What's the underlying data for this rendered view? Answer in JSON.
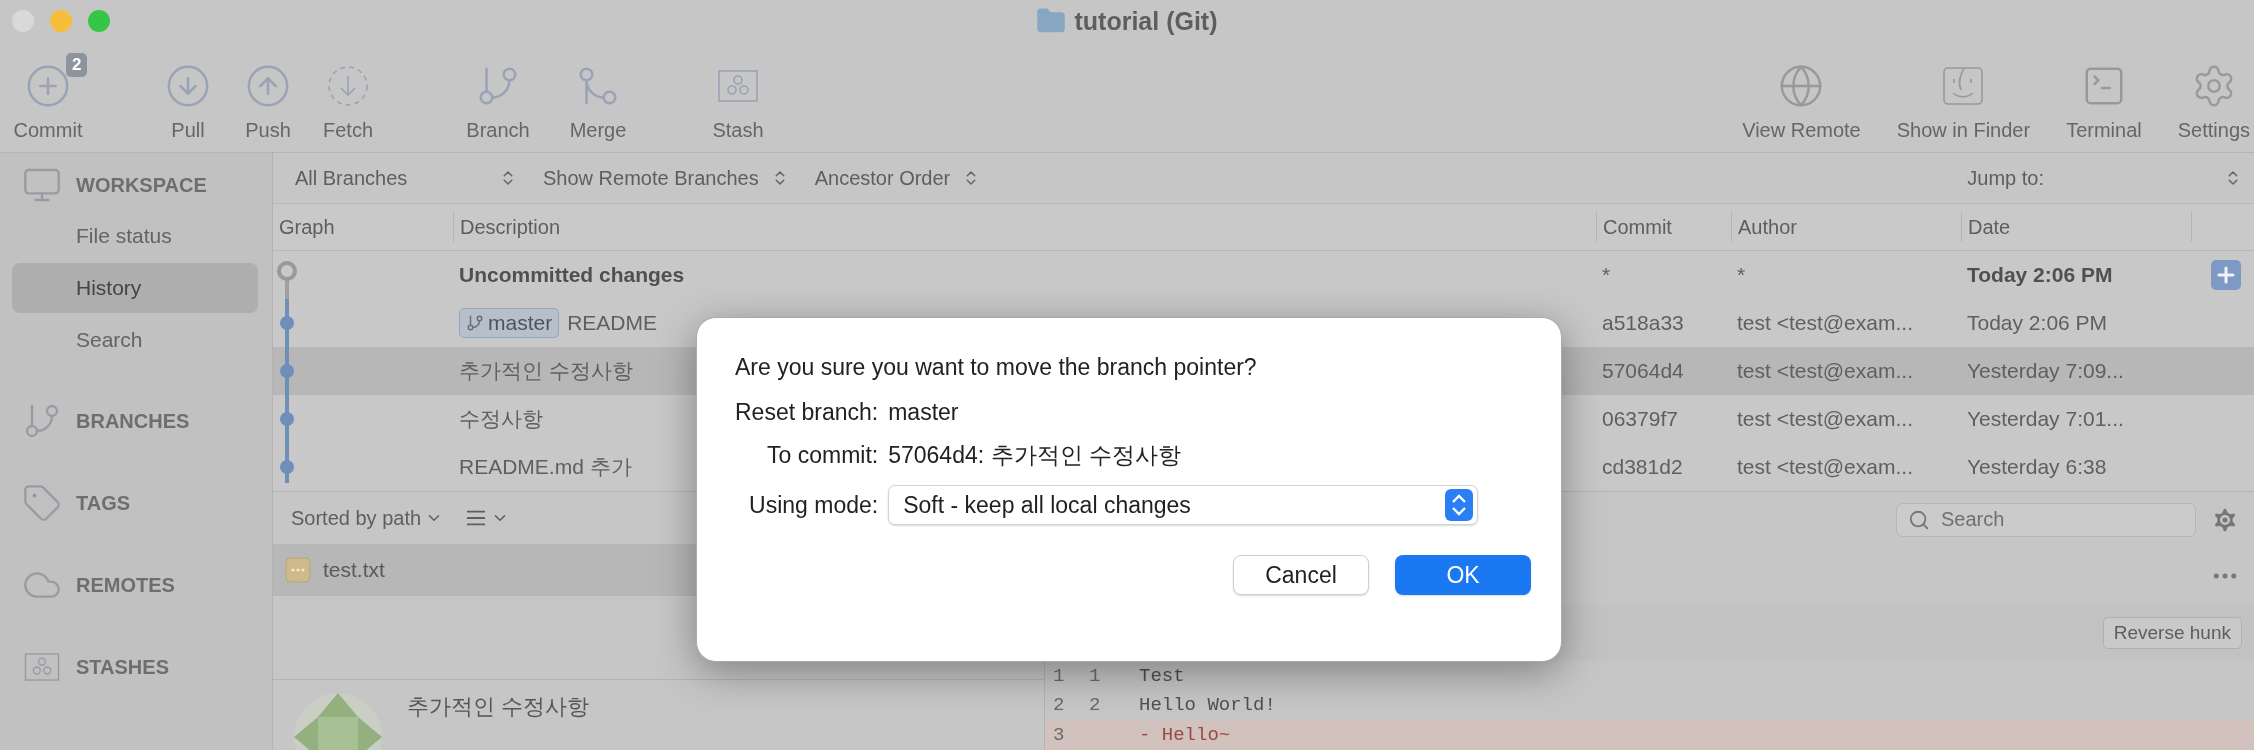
{
  "window": {
    "title": "tutorial (Git)"
  },
  "toolbar": {
    "left": [
      [
        {
          "kind": "commit",
          "label": "Commit",
          "badge": "2"
        }
      ],
      [
        {
          "kind": "pull",
          "label": "Pull"
        },
        {
          "kind": "push",
          "label": "Push"
        },
        {
          "kind": "fetch",
          "label": "Fetch"
        }
      ],
      [
        {
          "kind": "branch",
          "label": "Branch"
        },
        {
          "kind": "merge",
          "label": "Merge"
        }
      ],
      [
        {
          "kind": "stash",
          "label": "Stash"
        }
      ]
    ],
    "right": [
      {
        "kind": "remote",
        "label": "View Remote"
      },
      {
        "kind": "finder",
        "label": "Show in Finder"
      },
      {
        "kind": "terminal",
        "label": "Terminal"
      },
      {
        "kind": "settings",
        "label": "Settings"
      }
    ]
  },
  "sidebar": [
    {
      "kind": "workspace",
      "title": "WORKSPACE",
      "items": [
        {
          "label": "File status",
          "selected": false
        },
        {
          "label": "History",
          "selected": true
        },
        {
          "label": "Search",
          "selected": false
        }
      ]
    },
    {
      "kind": "branches",
      "title": "BRANCHES"
    },
    {
      "kind": "tags",
      "title": "TAGS"
    },
    {
      "kind": "remotes",
      "title": "REMOTES"
    },
    {
      "kind": "stashes",
      "title": "STASHES"
    }
  ],
  "filters": [
    "All Branches",
    "Show Remote Branches",
    "Ancestor Order"
  ],
  "jump_to": {
    "label": "Jump to:"
  },
  "table": {
    "columns": [
      "Graph",
      "Description",
      "Commit",
      "Author",
      "Date"
    ],
    "rows": [
      {
        "kind": "uncommitted",
        "description": "Uncommitted changes",
        "commit": "*",
        "author": "*",
        "date": "Today 2:06 PM",
        "selected": false
      },
      {
        "kind": "commit",
        "branch": "master",
        "description": "README",
        "commit": "a518a33",
        "author": "test <test@exam...",
        "date": "Today 2:06 PM",
        "selected": false
      },
      {
        "kind": "commit",
        "description": "추가적인 수정사항",
        "commit": "57064d4",
        "author": "test <test@exam...",
        "date": "Yesterday 7:09...",
        "selected": true
      },
      {
        "kind": "commit",
        "description": "수정사항",
        "commit": "06379f7",
        "author": "test <test@exam...",
        "date": "Yesterday 7:01...",
        "selected": false
      },
      {
        "kind": "commit",
        "description": "README.md 추가",
        "commit": "cd381d2",
        "author": "test <test@exam...",
        "date": "Yesterday 6:38",
        "selected": false
      }
    ]
  },
  "files": {
    "sort": "Sorted by path",
    "items": [
      {
        "name": "test.txt",
        "selected": true
      }
    ]
  },
  "commit_detail": {
    "title": "추가적인 수정사항"
  },
  "diff": {
    "search": {
      "placeholder": "Search"
    },
    "reverse_hunk": "Reverse hunk",
    "lines": [
      {
        "kind": "context",
        "old": "1",
        "new": "1",
        "text": "Test"
      },
      {
        "kind": "context",
        "old": "2",
        "new": "2",
        "text": "Hello World!"
      },
      {
        "kind": "removed",
        "old": "3",
        "marker": "-",
        "text": "Hello~"
      }
    ]
  },
  "dialog": {
    "question": "Are you sure you want to move the branch pointer?",
    "fields": [
      {
        "kind": "text",
        "label": "Reset branch:",
        "value": "master"
      },
      {
        "kind": "text",
        "label": "To commit:",
        "value": "57064d4: 추가적인 수정사항"
      },
      {
        "kind": "select",
        "label": "Using mode:",
        "value": "Soft - keep all local changes"
      }
    ],
    "buttons": [
      {
        "label": "Cancel",
        "primary": false
      },
      {
        "label": "OK",
        "primary": true
      }
    ]
  }
}
